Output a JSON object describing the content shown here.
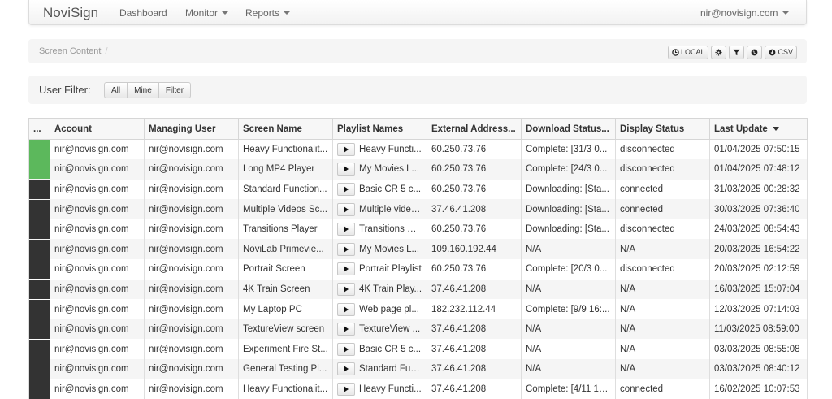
{
  "navbar": {
    "brand": "NoviSign",
    "items": [
      {
        "label": "Dashboard",
        "dropdown": false
      },
      {
        "label": "Monitor",
        "dropdown": true
      },
      {
        "label": "Reports",
        "dropdown": true
      }
    ],
    "user": "nir@novisign.com"
  },
  "breadcrumb": {
    "current": "Screen Content",
    "separator": "/"
  },
  "toolbar": {
    "local_label": "LOCAL",
    "csv_label": "CSV",
    "icons": [
      "clock-icon",
      "gear-icon",
      "filter-icon",
      "globe-icon",
      "download-icon"
    ]
  },
  "user_filter": {
    "label": "User Filter:",
    "options": [
      "All",
      "Mine",
      "Filter"
    ]
  },
  "colors": {
    "online": "#5cb85c",
    "offline": "#333333"
  },
  "table": {
    "columns": [
      "...",
      "Account",
      "Managing User",
      "Screen Name",
      "Playlist Names",
      "External Address...",
      "Download Status...",
      "Display Status",
      "Last Update"
    ],
    "sorted_column": "Last Update",
    "sort_direction": "desc",
    "rows": [
      {
        "status": "online",
        "account": "nir@novisign.com",
        "managing_user": "nir@novisign.com",
        "screen_name": "Heavy Functionalit...",
        "playlist": "Heavy Functi...",
        "external_address": "60.250.73.76",
        "download_status": "Complete: [31/3 0...",
        "display_status": "disconnected",
        "last_update": "01/04/2025 07:50:15"
      },
      {
        "status": "online",
        "account": "nir@novisign.com",
        "managing_user": "nir@novisign.com",
        "screen_name": "Long MP4 Player",
        "playlist": "My Movies L...",
        "external_address": "60.250.73.76",
        "download_status": "Complete: [24/3 0...",
        "display_status": "disconnected",
        "last_update": "01/04/2025 07:48:12"
      },
      {
        "status": "offline",
        "account": "nir@novisign.com",
        "managing_user": "nir@novisign.com",
        "screen_name": "Standard Function...",
        "playlist": "Basic CR 5 c...",
        "external_address": "60.250.73.76",
        "download_status": "Downloading: [Sta...",
        "display_status": "connected",
        "last_update": "31/03/2025 00:28:32"
      },
      {
        "status": "offline",
        "account": "nir@novisign.com",
        "managing_user": "nir@novisign.com",
        "screen_name": "Multiple Videos Sc...",
        "playlist": "Multiple video...",
        "external_address": "37.46.41.208",
        "download_status": "Downloading: [Sta...",
        "display_status": "connected",
        "last_update": "30/03/2025 07:36:40"
      },
      {
        "status": "offline",
        "account": "nir@novisign.com",
        "managing_user": "nir@novisign.com",
        "screen_name": "Transitions Player",
        "playlist": "Transitions Pl...",
        "external_address": "60.250.73.76",
        "download_status": "Downloading: [Sta...",
        "display_status": "disconnected",
        "last_update": "24/03/2025 08:54:43"
      },
      {
        "status": "offline",
        "account": "nir@novisign.com",
        "managing_user": "nir@novisign.com",
        "screen_name": "NoviLab Primevie...",
        "playlist": "My Movies L...",
        "external_address": "109.160.192.44",
        "download_status": "N/A",
        "display_status": "N/A",
        "last_update": "20/03/2025 16:54:22"
      },
      {
        "status": "offline",
        "account": "nir@novisign.com",
        "managing_user": "nir@novisign.com",
        "screen_name": "Portrait Screen",
        "playlist": "Portrait Playlist",
        "external_address": "60.250.73.76",
        "download_status": "Complete: [20/3 0...",
        "display_status": "disconnected",
        "last_update": "20/03/2025 02:12:59"
      },
      {
        "status": "offline",
        "account": "nir@novisign.com",
        "managing_user": "nir@novisign.com",
        "screen_name": "4K Train Screen",
        "playlist": "4K Train Play...",
        "external_address": "37.46.41.208",
        "download_status": "N/A",
        "display_status": "N/A",
        "last_update": "16/03/2025 15:07:04"
      },
      {
        "status": "offline",
        "account": "nir@novisign.com",
        "managing_user": "nir@novisign.com",
        "screen_name": "My Laptop PC",
        "playlist": "Web page pl...",
        "external_address": "182.232.112.44",
        "download_status": "Complete: [9/9 16:...",
        "display_status": "N/A",
        "last_update": "12/03/2025 07:14:03"
      },
      {
        "status": "offline",
        "account": "nir@novisign.com",
        "managing_user": "nir@novisign.com",
        "screen_name": "TextureView screen",
        "playlist": "TextureView ...",
        "external_address": "37.46.41.208",
        "download_status": "N/A",
        "display_status": "N/A",
        "last_update": "11/03/2025 08:59:00"
      },
      {
        "status": "offline",
        "account": "nir@novisign.com",
        "managing_user": "nir@novisign.com",
        "screen_name": "Experiment Fire St...",
        "playlist": "Basic CR 5 c...",
        "external_address": "37.46.41.208",
        "download_status": "N/A",
        "display_status": "N/A",
        "last_update": "03/03/2025 08:55:08"
      },
      {
        "status": "offline",
        "account": "nir@novisign.com",
        "managing_user": "nir@novisign.com",
        "screen_name": "General Testing Pl...",
        "playlist": "Standard Fun...",
        "external_address": "37.46.41.208",
        "download_status": "N/A",
        "display_status": "N/A",
        "last_update": "03/03/2025 08:40:12"
      },
      {
        "status": "offline",
        "account": "nir@novisign.com",
        "managing_user": "nir@novisign.com",
        "screen_name": "Heavy Functionalit...",
        "playlist": "Heavy Functi...",
        "external_address": "37.46.41.208",
        "download_status": "Complete: [4/11 15...",
        "display_status": "connected",
        "last_update": "16/02/2025 10:07:53"
      }
    ]
  }
}
